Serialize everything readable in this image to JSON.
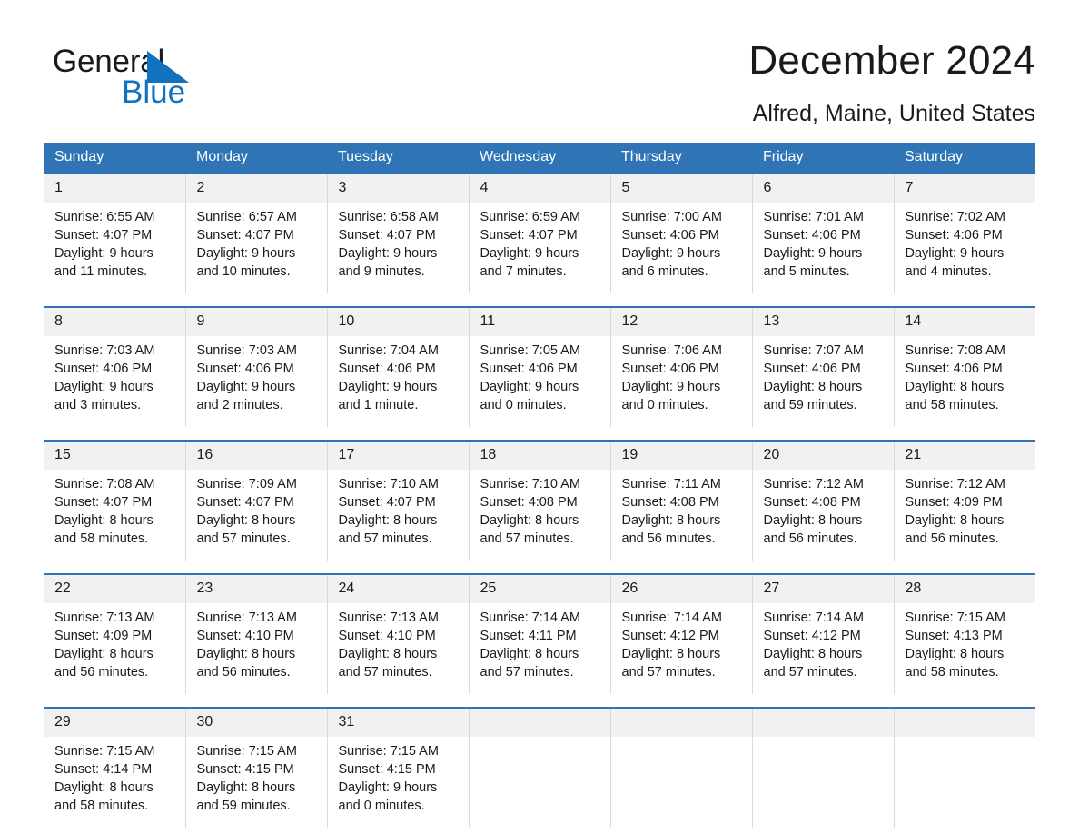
{
  "brand": {
    "name_part1": "General",
    "name_part2": "Blue",
    "triangle_color": "#1372bd",
    "accent_color": "#2f75b5"
  },
  "header": {
    "title": "December 2024",
    "subtitle": "Alfred, Maine, United States"
  },
  "weekday_headers": [
    "Sunday",
    "Monday",
    "Tuesday",
    "Wednesday",
    "Thursday",
    "Friday",
    "Saturday"
  ],
  "weeks": [
    {
      "days": [
        {
          "date": "1",
          "sunrise": "Sunrise: 6:55 AM",
          "sunset": "Sunset: 4:07 PM",
          "daylight_line1": "Daylight: 9 hours",
          "daylight_line2": "and 11 minutes."
        },
        {
          "date": "2",
          "sunrise": "Sunrise: 6:57 AM",
          "sunset": "Sunset: 4:07 PM",
          "daylight_line1": "Daylight: 9 hours",
          "daylight_line2": "and 10 minutes."
        },
        {
          "date": "3",
          "sunrise": "Sunrise: 6:58 AM",
          "sunset": "Sunset: 4:07 PM",
          "daylight_line1": "Daylight: 9 hours",
          "daylight_line2": "and 9 minutes."
        },
        {
          "date": "4",
          "sunrise": "Sunrise: 6:59 AM",
          "sunset": "Sunset: 4:07 PM",
          "daylight_line1": "Daylight: 9 hours",
          "daylight_line2": "and 7 minutes."
        },
        {
          "date": "5",
          "sunrise": "Sunrise: 7:00 AM",
          "sunset": "Sunset: 4:06 PM",
          "daylight_line1": "Daylight: 9 hours",
          "daylight_line2": "and 6 minutes."
        },
        {
          "date": "6",
          "sunrise": "Sunrise: 7:01 AM",
          "sunset": "Sunset: 4:06 PM",
          "daylight_line1": "Daylight: 9 hours",
          "daylight_line2": "and 5 minutes."
        },
        {
          "date": "7",
          "sunrise": "Sunrise: 7:02 AM",
          "sunset": "Sunset: 4:06 PM",
          "daylight_line1": "Daylight: 9 hours",
          "daylight_line2": "and 4 minutes."
        }
      ]
    },
    {
      "days": [
        {
          "date": "8",
          "sunrise": "Sunrise: 7:03 AM",
          "sunset": "Sunset: 4:06 PM",
          "daylight_line1": "Daylight: 9 hours",
          "daylight_line2": "and 3 minutes."
        },
        {
          "date": "9",
          "sunrise": "Sunrise: 7:03 AM",
          "sunset": "Sunset: 4:06 PM",
          "daylight_line1": "Daylight: 9 hours",
          "daylight_line2": "and 2 minutes."
        },
        {
          "date": "10",
          "sunrise": "Sunrise: 7:04 AM",
          "sunset": "Sunset: 4:06 PM",
          "daylight_line1": "Daylight: 9 hours",
          "daylight_line2": "and 1 minute."
        },
        {
          "date": "11",
          "sunrise": "Sunrise: 7:05 AM",
          "sunset": "Sunset: 4:06 PM",
          "daylight_line1": "Daylight: 9 hours",
          "daylight_line2": "and 0 minutes."
        },
        {
          "date": "12",
          "sunrise": "Sunrise: 7:06 AM",
          "sunset": "Sunset: 4:06 PM",
          "daylight_line1": "Daylight: 9 hours",
          "daylight_line2": "and 0 minutes."
        },
        {
          "date": "13",
          "sunrise": "Sunrise: 7:07 AM",
          "sunset": "Sunset: 4:06 PM",
          "daylight_line1": "Daylight: 8 hours",
          "daylight_line2": "and 59 minutes."
        },
        {
          "date": "14",
          "sunrise": "Sunrise: 7:08 AM",
          "sunset": "Sunset: 4:06 PM",
          "daylight_line1": "Daylight: 8 hours",
          "daylight_line2": "and 58 minutes."
        }
      ]
    },
    {
      "days": [
        {
          "date": "15",
          "sunrise": "Sunrise: 7:08 AM",
          "sunset": "Sunset: 4:07 PM",
          "daylight_line1": "Daylight: 8 hours",
          "daylight_line2": "and 58 minutes."
        },
        {
          "date": "16",
          "sunrise": "Sunrise: 7:09 AM",
          "sunset": "Sunset: 4:07 PM",
          "daylight_line1": "Daylight: 8 hours",
          "daylight_line2": "and 57 minutes."
        },
        {
          "date": "17",
          "sunrise": "Sunrise: 7:10 AM",
          "sunset": "Sunset: 4:07 PM",
          "daylight_line1": "Daylight: 8 hours",
          "daylight_line2": "and 57 minutes."
        },
        {
          "date": "18",
          "sunrise": "Sunrise: 7:10 AM",
          "sunset": "Sunset: 4:08 PM",
          "daylight_line1": "Daylight: 8 hours",
          "daylight_line2": "and 57 minutes."
        },
        {
          "date": "19",
          "sunrise": "Sunrise: 7:11 AM",
          "sunset": "Sunset: 4:08 PM",
          "daylight_line1": "Daylight: 8 hours",
          "daylight_line2": "and 56 minutes."
        },
        {
          "date": "20",
          "sunrise": "Sunrise: 7:12 AM",
          "sunset": "Sunset: 4:08 PM",
          "daylight_line1": "Daylight: 8 hours",
          "daylight_line2": "and 56 minutes."
        },
        {
          "date": "21",
          "sunrise": "Sunrise: 7:12 AM",
          "sunset": "Sunset: 4:09 PM",
          "daylight_line1": "Daylight: 8 hours",
          "daylight_line2": "and 56 minutes."
        }
      ]
    },
    {
      "days": [
        {
          "date": "22",
          "sunrise": "Sunrise: 7:13 AM",
          "sunset": "Sunset: 4:09 PM",
          "daylight_line1": "Daylight: 8 hours",
          "daylight_line2": "and 56 minutes."
        },
        {
          "date": "23",
          "sunrise": "Sunrise: 7:13 AM",
          "sunset": "Sunset: 4:10 PM",
          "daylight_line1": "Daylight: 8 hours",
          "daylight_line2": "and 56 minutes."
        },
        {
          "date": "24",
          "sunrise": "Sunrise: 7:13 AM",
          "sunset": "Sunset: 4:10 PM",
          "daylight_line1": "Daylight: 8 hours",
          "daylight_line2": "and 57 minutes."
        },
        {
          "date": "25",
          "sunrise": "Sunrise: 7:14 AM",
          "sunset": "Sunset: 4:11 PM",
          "daylight_line1": "Daylight: 8 hours",
          "daylight_line2": "and 57 minutes."
        },
        {
          "date": "26",
          "sunrise": "Sunrise: 7:14 AM",
          "sunset": "Sunset: 4:12 PM",
          "daylight_line1": "Daylight: 8 hours",
          "daylight_line2": "and 57 minutes."
        },
        {
          "date": "27",
          "sunrise": "Sunrise: 7:14 AM",
          "sunset": "Sunset: 4:12 PM",
          "daylight_line1": "Daylight: 8 hours",
          "daylight_line2": "and 57 minutes."
        },
        {
          "date": "28",
          "sunrise": "Sunrise: 7:15 AM",
          "sunset": "Sunset: 4:13 PM",
          "daylight_line1": "Daylight: 8 hours",
          "daylight_line2": "and 58 minutes."
        }
      ]
    },
    {
      "days": [
        {
          "date": "29",
          "sunrise": "Sunrise: 7:15 AM",
          "sunset": "Sunset: 4:14 PM",
          "daylight_line1": "Daylight: 8 hours",
          "daylight_line2": "and 58 minutes."
        },
        {
          "date": "30",
          "sunrise": "Sunrise: 7:15 AM",
          "sunset": "Sunset: 4:15 PM",
          "daylight_line1": "Daylight: 8 hours",
          "daylight_line2": "and 59 minutes."
        },
        {
          "date": "31",
          "sunrise": "Sunrise: 7:15 AM",
          "sunset": "Sunset: 4:15 PM",
          "daylight_line1": "Daylight: 9 hours",
          "daylight_line2": "and 0 minutes."
        },
        {
          "date": "",
          "sunrise": "",
          "sunset": "",
          "daylight_line1": "",
          "daylight_line2": ""
        },
        {
          "date": "",
          "sunrise": "",
          "sunset": "",
          "daylight_line1": "",
          "daylight_line2": ""
        },
        {
          "date": "",
          "sunrise": "",
          "sunset": "",
          "daylight_line1": "",
          "daylight_line2": ""
        },
        {
          "date": "",
          "sunrise": "",
          "sunset": "",
          "daylight_line1": "",
          "daylight_line2": ""
        }
      ]
    }
  ]
}
